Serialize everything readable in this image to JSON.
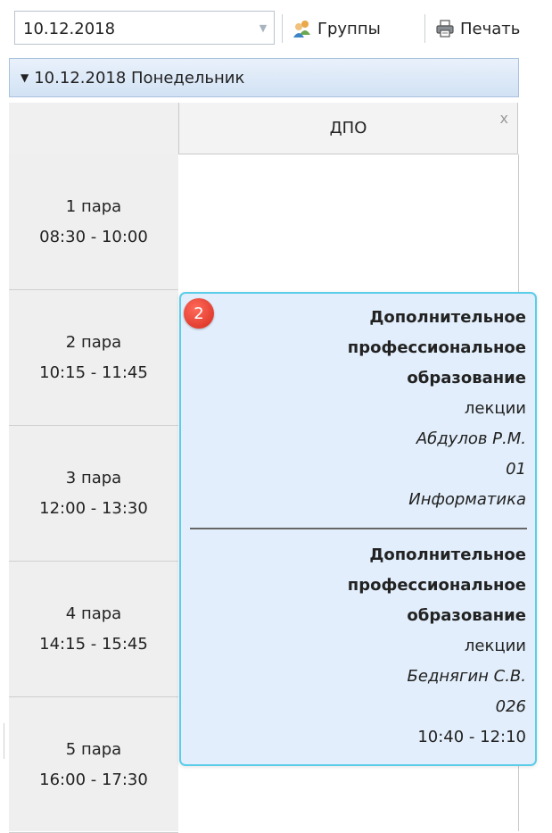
{
  "toolbar": {
    "date": "10.12.2018",
    "groups_label": "Группы",
    "print_label": "Печать"
  },
  "day": {
    "label": "10.12.2018 Понедельник"
  },
  "column": {
    "title": "ДПО",
    "close": "x"
  },
  "slots": [
    {
      "name": "1 пара",
      "time": "08:30 - 10:00"
    },
    {
      "name": "2 пара",
      "time": "10:15 - 11:45"
    },
    {
      "name": "3 пара",
      "time": "12:00 - 13:30"
    },
    {
      "name": "4 пара",
      "time": "14:15 - 15:45"
    },
    {
      "name": "5 пара",
      "time": "16:00 - 17:30"
    }
  ],
  "event_card": {
    "count": "2",
    "events": [
      {
        "title_lines": [
          "Дополнительное",
          "профессиональное",
          "образование"
        ],
        "type": "лекции",
        "teacher": "Абдулов Р.М.",
        "room": "01",
        "subject": "Информатика"
      },
      {
        "title_lines": [
          "Дополнительное",
          "профессиональное",
          "образование"
        ],
        "type": "лекции",
        "teacher": "Беднягин С.В.",
        "room": "026",
        "time": "10:40 - 12:10"
      }
    ]
  },
  "colors": {
    "card_bg": "#e2eefb",
    "card_border": "#5ccde9",
    "badge": "#e0392b",
    "header_bg": "#d2e2f4"
  },
  "icons": {
    "groups": "users-icon",
    "print": "printer-icon",
    "dropdown": "chevron-down-icon",
    "collapse": "caret-down-icon",
    "close": "close-icon"
  }
}
